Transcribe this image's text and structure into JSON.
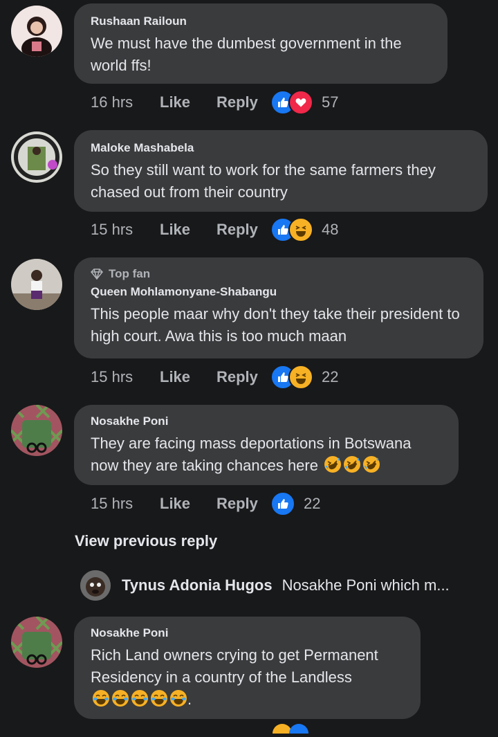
{
  "comments": [
    {
      "author": "Rushaan Railoun",
      "text": "We must have the dumbest government in the world ffs!",
      "time": "16 hrs",
      "like_label": "Like",
      "reply_label": "Reply",
      "reactions": [
        "like",
        "love"
      ],
      "reaction_count": "57"
    },
    {
      "author": "Maloke Mashabela",
      "text": "So they still want to work for the same farmers they chased out from their country",
      "time": "15 hrs",
      "like_label": "Like",
      "reply_label": "Reply",
      "reactions": [
        "like",
        "haha"
      ],
      "reaction_count": "48"
    },
    {
      "badge": "Top fan",
      "author": "Queen Mohlamonyane-Shabangu",
      "text": "This  people maar why don't they take their president to high court. Awa this is too much maan",
      "time": "15 hrs",
      "like_label": "Like",
      "reply_label": "Reply",
      "reactions": [
        "like",
        "haha"
      ],
      "reaction_count": "22"
    },
    {
      "author": "Nosakhe Poni",
      "text": "They are facing mass deportations in Botswana now they are taking chances here",
      "emojis": [
        "rofl",
        "rofl",
        "rofl"
      ],
      "time": "15 hrs",
      "like_label": "Like",
      "reply_label": "Reply",
      "reactions": [
        "like"
      ],
      "reaction_count": "22"
    },
    {
      "author": "Nosakhe Poni",
      "text": "Rich Land owners crying to get Permanent Residency in a country of the Landless",
      "emojis": [
        "joy",
        "joy",
        "joy",
        "joy",
        "joy"
      ],
      "trailing": "."
    }
  ],
  "view_previous": "View previous reply",
  "reply_preview": {
    "author": "Tynus Adonia Hugos",
    "text": "Nosakhe Poni which m..."
  },
  "colors": {
    "background": "#18191a",
    "bubble": "#3a3b3c",
    "like_blue": "#1877f2",
    "love_red": "#f02849",
    "haha_yellow": "#f7b125"
  }
}
